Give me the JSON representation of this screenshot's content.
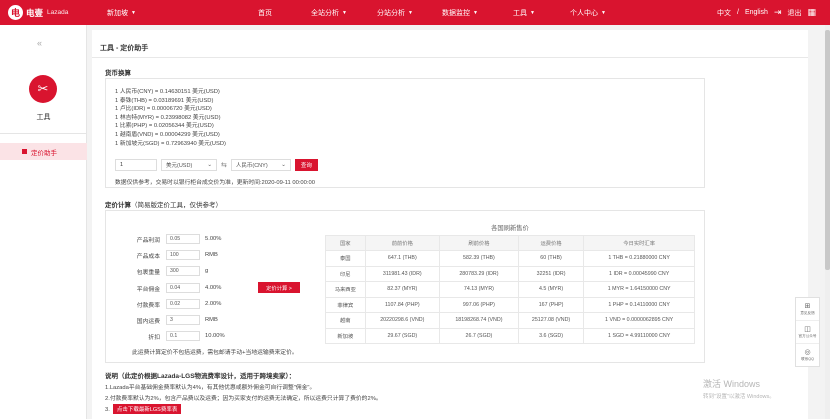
{
  "topbar": {
    "logo_mark": "电",
    "logo_text": "电壹",
    "logo_sub": "Lazada",
    "nav": [
      {
        "label": "新加坡",
        "caret": "▼"
      },
      {
        "label": "首页",
        "caret": ""
      },
      {
        "label": "全站分析",
        "caret": "▼"
      },
      {
        "label": "分站分析",
        "caret": "▼"
      },
      {
        "label": "数据监控",
        "caret": "▼"
      },
      {
        "label": "工具",
        "caret": "▼"
      },
      {
        "label": "个人中心",
        "caret": "▼"
      }
    ],
    "lang_cn": "中文",
    "lang_sep": "/",
    "lang_en": "English",
    "logout": "退出"
  },
  "sidebar": {
    "collapse_glyph": "«",
    "tool_label": "工具",
    "items": [
      {
        "label": "定价助手"
      }
    ]
  },
  "main": {
    "title": "工具 - 定价助手",
    "currency": {
      "heading": "货币换算",
      "rates": [
        "1 人民币(CNY) = 0.14630151 美元(USD)",
        "1 泰铢(THB) = 0.03189691 美元(USD)",
        "1 卢比(IDR) = 0.00006720 美元(USD)",
        "1 林吉特(MYR) = 0.23998082 美元(USD)",
        "1 比索(PHP) = 0.02056344 美元(USD)",
        "1 越南盾(VND) = 0.00004299 美元(USD)",
        "1 新加坡元(SGD) = 0.72963940 美元(USD)"
      ],
      "amount": "1",
      "from": "美元(USD)",
      "swap": "⇆",
      "to": "人民币(CNY)",
      "query_button": "查询",
      "note": "数据仅供参考，交易时以银行柜台成交价为准，更新时间:2020-09-11 00:00:00"
    },
    "pricing": {
      "heading": "定价计算",
      "heading_note": "（简易版定价工具，仅供参考）",
      "fields": [
        {
          "label": "产品利润",
          "value": "0.05",
          "unit": "5.00%"
        },
        {
          "label": "产品成本",
          "value": "100",
          "unit": "RMB"
        },
        {
          "label": "包裹重量",
          "value": "300",
          "unit": "g"
        },
        {
          "label": "平台佣金",
          "value": "0.04",
          "unit": "4.00%"
        },
        {
          "label": "付款费率",
          "value": "0.02",
          "unit": "2.00%"
        },
        {
          "label": "国内运费",
          "value": "3",
          "unit": "RMB"
        },
        {
          "label": "折扣",
          "value": "0.1",
          "unit": "10.00%"
        }
      ],
      "calc_button": "定价计算 >",
      "note": "此运费计算定价不包括运费，需包邮请手动+当地运输费来定价。",
      "table": {
        "caption": "各国刷新售价",
        "headers": [
          "国家",
          "前前价格",
          "刷前价格",
          "运费价格",
          "今日实时汇率"
        ],
        "rows": [
          [
            "泰国",
            "647.1 (THB)",
            "582.39 (THB)",
            "60 (THB)",
            "1 THB = 0.21880000 CNY"
          ],
          [
            "印尼",
            "311981.43 (IDR)",
            "280783.29 (IDR)",
            "32251 (IDR)",
            "1 IDR = 0.00045990 CNY"
          ],
          [
            "马来西亚",
            "82.37 (MYR)",
            "74.13 (MYR)",
            "4.5 (MYR)",
            "1 MYR = 1.64150000 CNY"
          ],
          [
            "菲律宾",
            "1107.84 (PHP)",
            "997.06 (PHP)",
            "167 (PHP)",
            "1 PHP = 0.14110000 CNY"
          ],
          [
            "越南",
            "20220298.6 (VND)",
            "18198268.74 (VND)",
            "25127.08 (VND)",
            "1 VND = 0.0000062895 CNY"
          ],
          [
            "新加坡",
            "29.67 (SGD)",
            "26.7 (SGD)",
            "3.6 (SGD)",
            "1 SGD = 4.99110000 CNY"
          ]
        ]
      }
    },
    "description": {
      "heading": "说明（此定价根据Lazada-LGS物流费率设计，适用于跨境卖家）：",
      "lines": [
        "1.Lazada平台基础佣金费率默认为4%，有其他优惠或额外佣金可自行调整\"佣金\"。",
        "2.付款费率默认为2%，包含产品费以及运费；因为买家支付的运费无法确定，所以运费只计算了费价的2%。"
      ],
      "line3_prefix": "3.",
      "download_button": "点击下载最新LGS费率表"
    }
  },
  "float_panel": [
    {
      "icon": "⊞",
      "label": "意见反馈"
    },
    {
      "icon": "◫",
      "label": "官方公众号"
    },
    {
      "icon": "◎",
      "label": "联系QQ"
    }
  ],
  "watermark": {
    "line1": "激活 Windows",
    "line2": "转到\"设置\"以激活 Windows。"
  }
}
